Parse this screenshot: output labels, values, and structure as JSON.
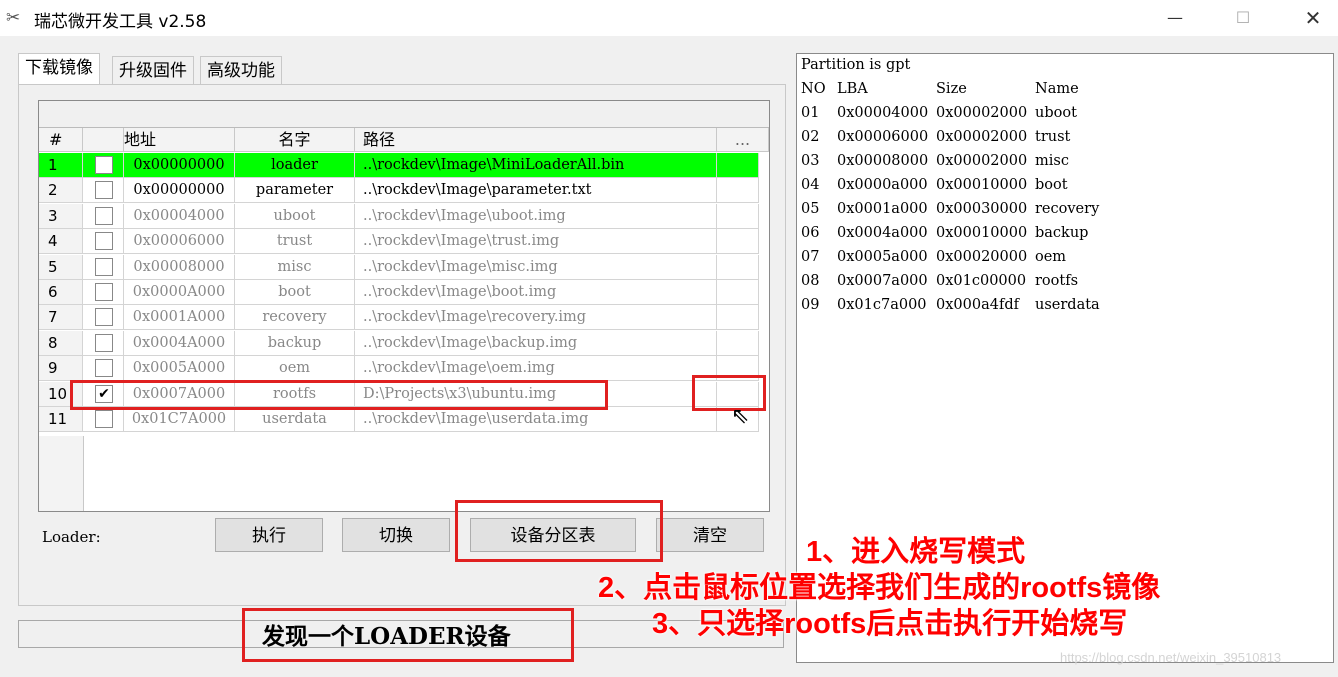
{
  "window": {
    "title": "瑞芯微开发工具 v2.58",
    "min": "—",
    "max": "☐",
    "close": "✕"
  },
  "tabs": [
    "下载镜像",
    "升级固件",
    "高级功能"
  ],
  "table": {
    "headers": [
      "#",
      "",
      "地址",
      "名字",
      "路径",
      "..."
    ],
    "rows": [
      {
        "num": "1",
        "checked": "",
        "addr": "0x00000000",
        "name": "loader",
        "path": "..\\rockdev\\Image\\MiniLoaderAll.bin"
      },
      {
        "num": "2",
        "checked": "",
        "addr": "0x00000000",
        "name": "parameter",
        "path": "..\\rockdev\\Image\\parameter.txt"
      },
      {
        "num": "3",
        "checked": "",
        "addr": "0x00004000",
        "name": "uboot",
        "path": "..\\rockdev\\Image\\uboot.img"
      },
      {
        "num": "4",
        "checked": "",
        "addr": "0x00006000",
        "name": "trust",
        "path": "..\\rockdev\\Image\\trust.img"
      },
      {
        "num": "5",
        "checked": "",
        "addr": "0x00008000",
        "name": "misc",
        "path": "..\\rockdev\\Image\\misc.img"
      },
      {
        "num": "6",
        "checked": "",
        "addr": "0x0000A000",
        "name": "boot",
        "path": "..\\rockdev\\Image\\boot.img"
      },
      {
        "num": "7",
        "checked": "",
        "addr": "0x0001A000",
        "name": "recovery",
        "path": "..\\rockdev\\Image\\recovery.img"
      },
      {
        "num": "8",
        "checked": "",
        "addr": "0x0004A000",
        "name": "backup",
        "path": "..\\rockdev\\Image\\backup.img"
      },
      {
        "num": "9",
        "checked": "",
        "addr": "0x0005A000",
        "name": "oem",
        "path": "..\\rockdev\\Image\\oem.img"
      },
      {
        "num": "10",
        "checked": "✔",
        "addr": "0x0007A000",
        "name": "rootfs",
        "path": "D:\\Projects\\x3\\ubuntu.img"
      },
      {
        "num": "11",
        "checked": "",
        "addr": "0x01C7A000",
        "name": "userdata",
        "path": "..\\rockdev\\Image\\userdata.img"
      }
    ]
  },
  "loader_label": "Loader:",
  "buttons": {
    "exec": "执行",
    "switch": "切换",
    "partition": "设备分区表",
    "clear": "清空"
  },
  "status": "发现一个LOADER设备",
  "log": {
    "title": "Partition is gpt",
    "header": [
      "NO",
      "LBA",
      "Size",
      "Name"
    ],
    "rows": [
      [
        "01",
        "0x00004000",
        "0x00002000",
        "uboot"
      ],
      [
        "02",
        "0x00006000",
        "0x00002000",
        "trust"
      ],
      [
        "03",
        "0x00008000",
        "0x00002000",
        "misc"
      ],
      [
        "04",
        "0x0000a000",
        "0x00010000",
        "boot"
      ],
      [
        "05",
        "0x0001a000",
        "0x00030000",
        "recovery"
      ],
      [
        "06",
        "0x0004a000",
        "0x00010000",
        "backup"
      ],
      [
        "07",
        "0x0005a000",
        "0x00020000",
        "oem"
      ],
      [
        "08",
        "0x0007a000",
        "0x01c00000",
        "rootfs"
      ],
      [
        "09",
        "0x01c7a000",
        "0x000a4fdf",
        "userdata"
      ]
    ]
  },
  "annotations": [
    "1、进入烧写模式",
    "2、点击鼠标位置选择我们生成的rootfs镜像",
    "3、只选择rootfs后点击执行开始烧写"
  ],
  "watermark": "https://blog.csdn.net/weixin_39510813",
  "colors": {
    "highlight": "#00ff00",
    "annotation": "#ff0000"
  }
}
